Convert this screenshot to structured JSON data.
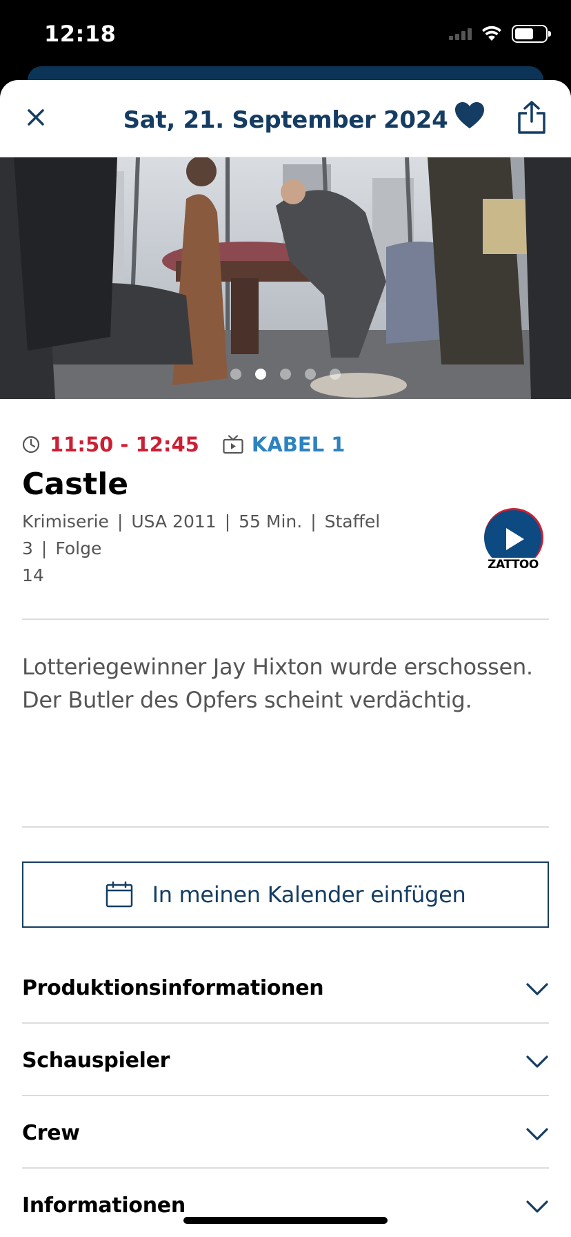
{
  "status_bar": {
    "time": "12:18"
  },
  "header": {
    "title": "Sat, 21. September 2024",
    "close_icon": "close-icon",
    "favorite_icon": "heart-icon",
    "share_icon": "share-icon"
  },
  "hero": {
    "image": "crime-scene-photo",
    "page_count": 5,
    "active_page": 2
  },
  "broadcast": {
    "time": "11:50 - 12:45",
    "channel": "KABEL 1"
  },
  "show": {
    "title": "Castle",
    "genre": "Krimiserie",
    "country_year": "USA 2011",
    "duration": "55 Min.",
    "season": "Staffel 3",
    "episode_word": "Folge",
    "episode_number": "14",
    "separator": "|"
  },
  "zattoo": {
    "label": "ZATTOO"
  },
  "description": "Lotteriegewinner Jay Hixton wurde erschossen. Der Butler des Opfers scheint verdächtig.",
  "calendar_button": {
    "label": "In meinen Kalender einfügen"
  },
  "accordion": [
    {
      "label": "Produktionsinformationen"
    },
    {
      "label": "Schauspieler"
    },
    {
      "label": "Crew"
    },
    {
      "label": "Informationen"
    }
  ],
  "colors": {
    "navy": "#153d63",
    "red": "#cc1f33",
    "blue": "#2d82c0"
  }
}
